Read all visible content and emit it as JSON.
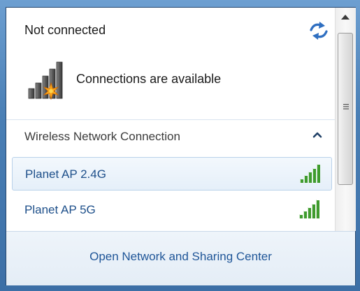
{
  "panel": {
    "status_title": "Not connected",
    "availability_text": "Connections are available",
    "refresh_icon": "refresh-arrows-icon",
    "signal_icon": "network-signal-with-star-icon"
  },
  "section": {
    "label": "Wireless Network Connection",
    "toggle_icon": "chevron-up-icon"
  },
  "networks": [
    {
      "name": "Planet AP 2.4G",
      "selected": true,
      "signal_icon": "signal-bars-icon"
    },
    {
      "name": "Planet AP 5G",
      "selected": false,
      "signal_icon": "signal-bars-icon"
    }
  ],
  "footer": {
    "link_text": "Open Network and Sharing Center"
  },
  "colors": {
    "link": "#1e5597",
    "signal_green": "#3f9b2e",
    "frame_border": "#26476e"
  }
}
